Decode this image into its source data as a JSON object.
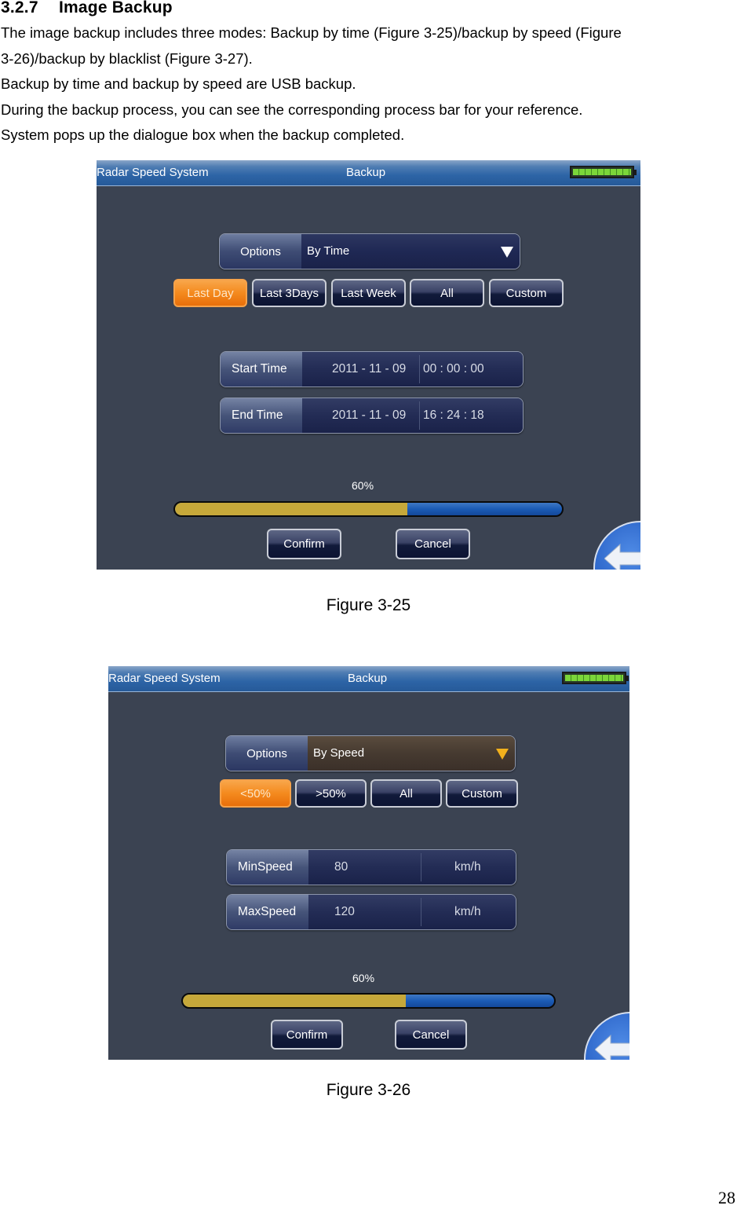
{
  "document": {
    "section_number": "3.2.7",
    "section_title": "Image Backup",
    "paragraphs": [
      "The image backup includes three modes: Backup by time (Figure 3-25)/backup by speed (Figure",
      "3-26)/backup by blacklist (Figure 3-27).",
      "Backup by time and backup by speed are USB backup.",
      "During the backup process, you can see the corresponding process bar for your reference.",
      "System pops up the dialogue box when the backup completed."
    ],
    "page_number": "28"
  },
  "figures": [
    {
      "caption": "Figure 3-25",
      "titlebar": {
        "app_name": "Radar Speed System",
        "page_title": "Backup",
        "battery_icon": "battery-full-icon"
      },
      "options": {
        "label": "Options",
        "selected": "By Time",
        "icon": "dropdown-arrow-icon"
      },
      "filter_buttons": [
        {
          "label": "Last Day",
          "active": true
        },
        {
          "label": "Last 3Days",
          "active": false
        },
        {
          "label": "Last Week",
          "active": false
        },
        {
          "label": "All",
          "active": false
        },
        {
          "label": "Custom",
          "active": false
        }
      ],
      "fields": [
        {
          "label": "Start Time",
          "date": "2011 - 11 - 09",
          "time": "00 : 00 : 00"
        },
        {
          "label": "End Time",
          "date": "2011 - 11 - 09",
          "time": "16 : 24 : 18"
        }
      ],
      "progress": {
        "label": "60%",
        "value": 0.6
      },
      "actions": {
        "confirm": "Confirm",
        "cancel": "Cancel",
        "back_icon": "back-arrow-icon"
      }
    },
    {
      "caption": "Figure 3-26",
      "titlebar": {
        "app_name": "Radar Speed System",
        "page_title": "Backup",
        "battery_icon": "battery-full-icon"
      },
      "options": {
        "label": "Options",
        "selected": "By Speed",
        "icon": "dropdown-arrow-icon"
      },
      "filter_buttons": [
        {
          "label": "<50%",
          "active": true
        },
        {
          "label": ">50%",
          "active": false
        },
        {
          "label": "All",
          "active": false
        },
        {
          "label": "Custom",
          "active": false
        }
      ],
      "fields": [
        {
          "label": "MinSpeed",
          "value": "80",
          "unit": "km/h"
        },
        {
          "label": "MaxSpeed",
          "value": "120",
          "unit": "km/h"
        }
      ],
      "progress": {
        "label": "60%",
        "value": 0.6
      },
      "actions": {
        "confirm": "Confirm",
        "cancel": "Cancel",
        "back_icon": "back-arrow-icon"
      }
    }
  ]
}
